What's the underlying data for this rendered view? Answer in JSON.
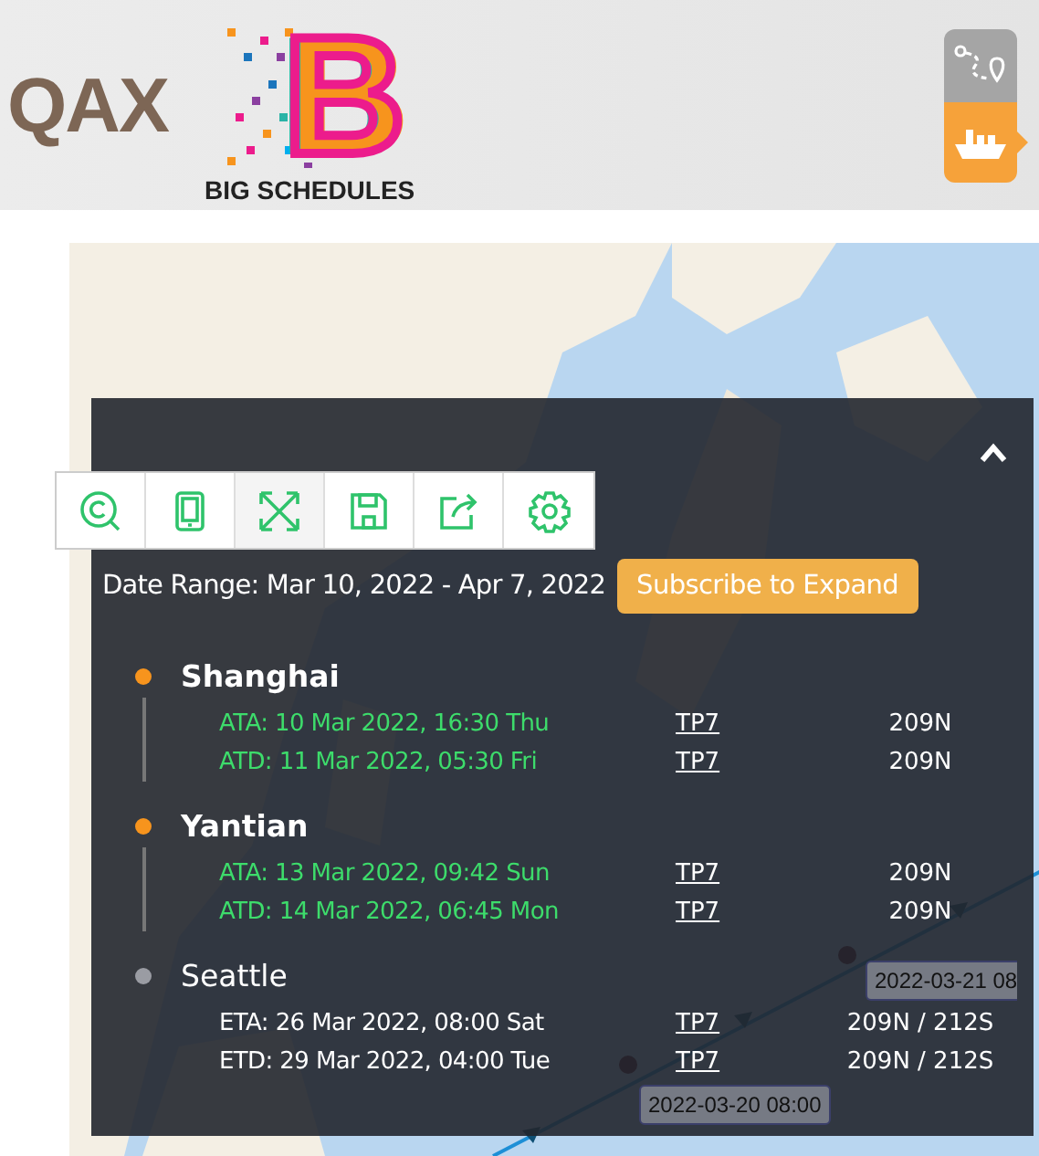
{
  "header": {
    "qax_logo": "QAX",
    "brand_mark": "B",
    "brand_name": "BIG SCHEDULES",
    "view_toggle": [
      {
        "kind": "route",
        "selected": false
      },
      {
        "kind": "ship",
        "selected": true
      }
    ]
  },
  "map": {
    "route_labels": [
      "2022-03-21 08",
      "2022-03-20 08:00"
    ]
  },
  "panel": {
    "toolbar": [
      {
        "kind": "search-c"
      },
      {
        "kind": "tablet"
      },
      {
        "kind": "expand"
      },
      {
        "kind": "save"
      },
      {
        "kind": "share"
      },
      {
        "kind": "settings"
      }
    ],
    "date_range": "Date Range: Mar 10, 2022 - Apr 7, 2022",
    "subscribe_button": "Subscribe to Expand",
    "stops": [
      {
        "name": "Shanghai",
        "color": "#f7941d",
        "events": [
          {
            "text": "ATA: 10 Mar 2022, 16:30 Thu",
            "actual": true,
            "vessel": "TP7",
            "voyage": "209N"
          },
          {
            "text": "ATD: 11 Mar 2022, 05:30 Fri",
            "actual": true,
            "vessel": "TP7",
            "voyage": "209N"
          }
        ]
      },
      {
        "name": "Yantian",
        "color": "#f7941d",
        "events": [
          {
            "text": "ATA: 13 Mar 2022, 09:42 Sun",
            "actual": true,
            "vessel": "TP7",
            "voyage": "209N"
          },
          {
            "text": "ATD: 14 Mar 2022, 06:45 Mon",
            "actual": true,
            "vessel": "TP7",
            "voyage": "209N"
          }
        ]
      },
      {
        "name": "Seattle",
        "color": "#9a9ca3",
        "events": [
          {
            "text": "ETA: 26 Mar 2022, 08:00 Sat",
            "actual": false,
            "vessel": "TP7",
            "voyage": "209N / 212S"
          },
          {
            "text": "ETD: 29 Mar 2022, 04:00 Tue",
            "actual": false,
            "vessel": "TP7",
            "voyage": "209N / 212S"
          }
        ]
      }
    ]
  }
}
